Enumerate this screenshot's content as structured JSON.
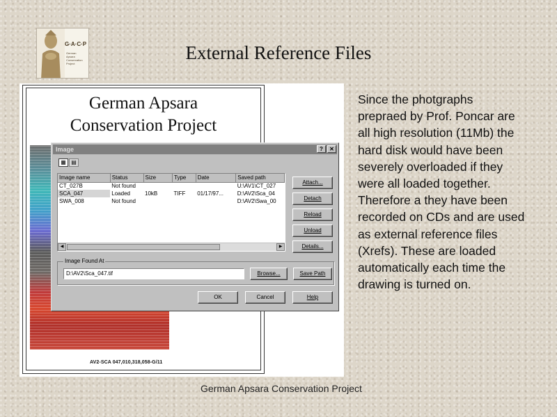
{
  "logo": {
    "brand": "G·A·C·P",
    "lines": [
      "German",
      "Apsara",
      "Conservation",
      "Project"
    ]
  },
  "slide": {
    "title": "External Reference Files",
    "body": "Since the photgraphs prepraed by Prof. Poncar are all high resolution (11Mb) the hard disk would have been severely overloaded if they were all loaded together. Therefore a they have been recorded on CDs and are used as external reference files (Xrefs). These are loaded automatically each time the drawing is turned on.",
    "footer": "German Apsara Conservation Project"
  },
  "paper": {
    "title_line1": "German Apsara",
    "title_line2": "Conservation Project",
    "caption": "AV2-SCA 047,010,318,058-G/11"
  },
  "dialog": {
    "title": "Image",
    "help_glyph": "?",
    "close_glyph": "✕",
    "columns": [
      "Image name",
      "Status",
      "Size",
      "Type",
      "Date",
      "Saved path"
    ],
    "rows": [
      [
        "CT_027B",
        "Not found",
        "",
        "",
        "",
        "U:\\AV1\\CT_027"
      ],
      [
        "SCA_047",
        "Loaded",
        "10kB",
        "TIFF",
        "01/17/97...",
        "D:\\AV2\\Sca_04"
      ],
      [
        "SWA_008",
        "Not found",
        "",
        "",
        "",
        "D:\\AV2\\Swa_00"
      ]
    ],
    "buttons": {
      "attach": "Attach...",
      "detach": "Detach",
      "reload": "Reload",
      "unload": "Unload",
      "details": "Details...",
      "browse": "Browse...",
      "save_path": "Save Path",
      "ok": "OK",
      "cancel": "Cancel",
      "help": "Help"
    },
    "found_at_label": "Image Found At",
    "found_at_value": "D:\\AV2\\Sca_047.tif"
  },
  "colors": {
    "background": "#ddd6c9",
    "dialog_face": "#c0c0c0",
    "titlebar": "#808080"
  }
}
